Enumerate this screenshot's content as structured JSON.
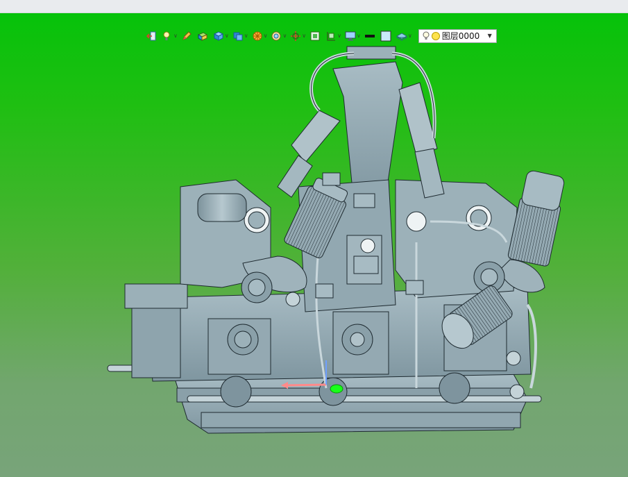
{
  "toolbar": {
    "tools": [
      {
        "name": "exit-icon",
        "dropdown": false
      },
      {
        "name": "light-icon",
        "dropdown": true
      },
      {
        "name": "pencil-icon",
        "dropdown": false
      },
      {
        "name": "solid-box-icon",
        "dropdown": false
      },
      {
        "name": "cube-view-icon",
        "dropdown": true
      },
      {
        "name": "display-style-icon",
        "dropdown": true
      },
      {
        "name": "section-wheel-icon",
        "dropdown": true
      },
      {
        "name": "zoom-icon",
        "dropdown": true
      },
      {
        "name": "rotate-axis-icon",
        "dropdown": true
      },
      {
        "name": "fit-window-icon",
        "dropdown": false
      },
      {
        "name": "frame-icon",
        "dropdown": true
      },
      {
        "name": "monitor-icon",
        "dropdown": true
      },
      {
        "name": "line-color-icon",
        "dropdown": false
      },
      {
        "name": "fill-color-icon",
        "dropdown": false
      },
      {
        "name": "layers-icon",
        "dropdown": true
      }
    ],
    "layer_select": {
      "value": "图层0000"
    }
  },
  "colors": {
    "background_top": "#06c20a",
    "background_bottom": "#78a47a",
    "model_fill": "#8fa5ae",
    "model_edge": "#1e2a30"
  }
}
